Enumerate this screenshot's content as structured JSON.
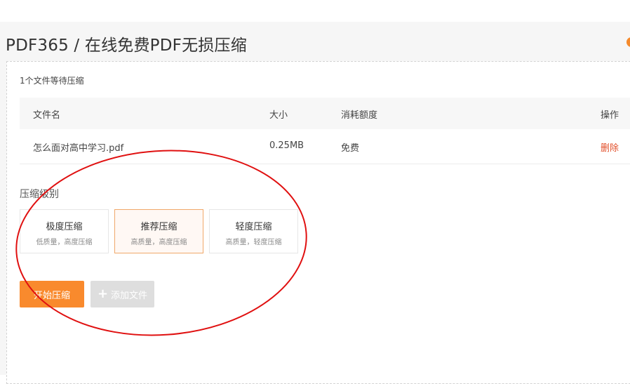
{
  "header": {
    "title": "PDF365 / 在线免费PDF无损压缩"
  },
  "panel": {
    "waiting_text": "1个文件等待压缩"
  },
  "table": {
    "headers": {
      "name": "文件名",
      "size": "大小",
      "quota": "消耗额度",
      "action": "操作"
    },
    "rows": [
      {
        "name": "怎么面对高中学习.pdf",
        "size": "0.25MB",
        "quota": "免费",
        "action": "删除"
      }
    ]
  },
  "compression": {
    "label": "压缩级别",
    "selected": 1,
    "options": [
      {
        "name": "极度压缩",
        "desc": "低质量，高度压缩"
      },
      {
        "name": "推荐压缩",
        "desc": "高质量，高度压缩"
      },
      {
        "name": "轻度压缩",
        "desc": "高质量，轻度压缩"
      }
    ]
  },
  "actions": {
    "start_label": "开始压缩",
    "add_label": "添加文件"
  },
  "colors": {
    "accent": "#f98a2d",
    "delete": "#e2502b",
    "annotation": "#e01010"
  },
  "icons": {
    "add": "plus-icon"
  }
}
